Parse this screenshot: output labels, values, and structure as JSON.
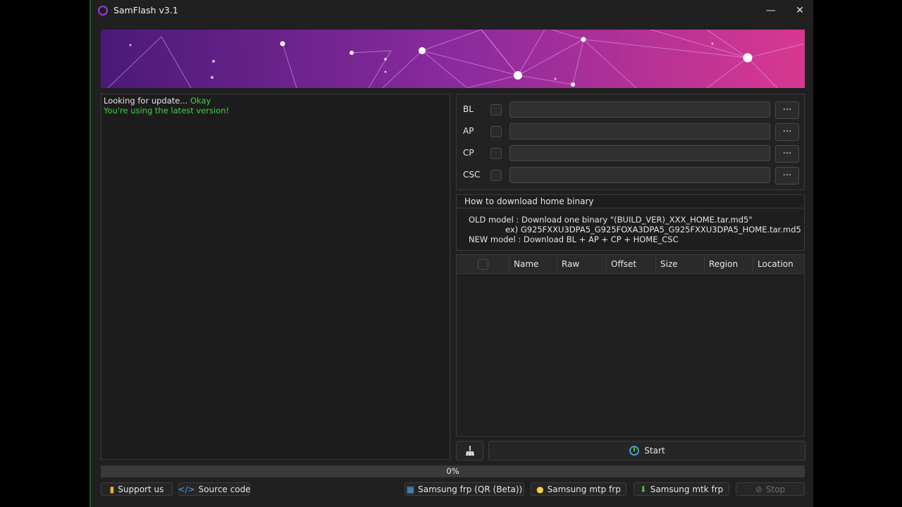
{
  "window": {
    "title": "SamFlash v3.1",
    "minimize_glyph": "—",
    "close_glyph": "✕"
  },
  "log": {
    "lines": [
      {
        "prefix": "Looking for update... ",
        "status": "Okay"
      },
      {
        "text": "You're using the latest version!"
      }
    ]
  },
  "files": [
    {
      "label": "BL",
      "value": "",
      "browse": "..."
    },
    {
      "label": "AP",
      "value": "",
      "browse": "..."
    },
    {
      "label": "CP",
      "value": "",
      "browse": "..."
    },
    {
      "label": "CSC",
      "value": "",
      "browse": "..."
    }
  ],
  "howto": {
    "title": "How to download home binary",
    "line1": "OLD model  : Download one binary \"(BUILD_VER)_XXX_HOME.tar.md5\"",
    "line2": "ex) G925FXXU3DPA5_G925FOXA3DPA5_G925FXXU3DPA5_HOME.tar.md5",
    "line3": "NEW model : Download BL + AP + CP + HOME_CSC"
  },
  "table": {
    "columns": [
      "Name",
      "Raw",
      "Offset",
      "Size",
      "Region",
      "Location"
    ],
    "rows": []
  },
  "actions": {
    "start": "Start"
  },
  "progress": {
    "value": 0,
    "label": "0%"
  },
  "bottom_buttons": {
    "support": "Support us",
    "source": "Source code",
    "frp_qr": "Samsung frp (QR (Beta))",
    "mtp_frp": "Samsung mtp frp",
    "mtk_frp": "Samsung mtk frp",
    "stop": "Stop"
  },
  "colors": {
    "accent_green": "#3fd23f",
    "banner_start": "#4a1a78",
    "banner_end": "#d8388f",
    "window_bg": "#202020"
  }
}
